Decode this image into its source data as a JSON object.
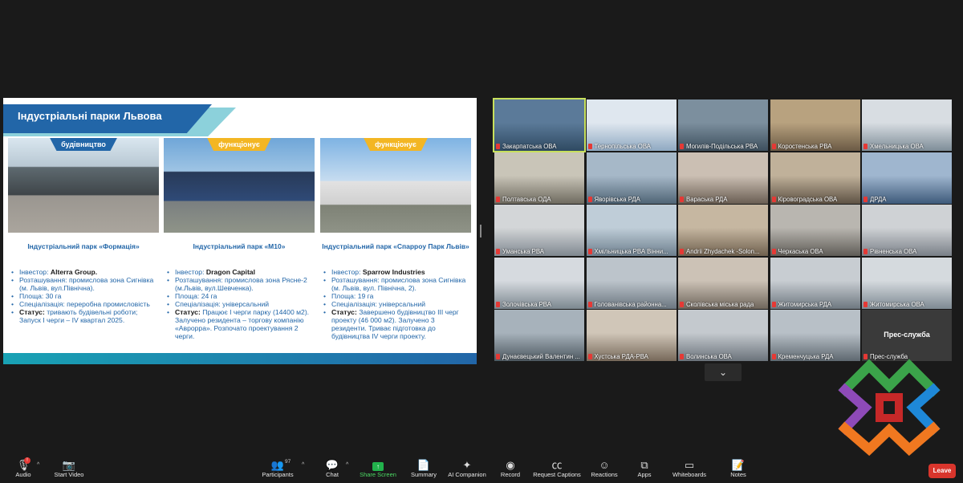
{
  "slide": {
    "title": "Індустріальні парки Львова",
    "parks": [
      {
        "badge": "будівництво",
        "name": "Індустріальний парк «Формація»",
        "details": [
          {
            "label": "Інвестор: ",
            "value": "Alterra Group."
          },
          {
            "label": "Розташування: промислова зона Сигнівка (м. Львів, вул.Північна).",
            "value": ""
          },
          {
            "label": "Площа: 30 га",
            "value": ""
          },
          {
            "label": "Спеціалізація: переробна промисловість",
            "value": ""
          },
          {
            "label": "",
            "value": "Статус:",
            "rest": " тривають будівельні роботи; Запуск I черги –  IV квартал 2025."
          }
        ]
      },
      {
        "badge": "функціонує",
        "name": "Індустріальний парк «М10»",
        "details": [
          {
            "label": "Інвестор: ",
            "value": "Dragon Capital"
          },
          {
            "label": "Розташування: промислова зона Рясне-2 (м.Львів, вул.Шевченка).",
            "value": ""
          },
          {
            "label": "Площа: 24 га",
            "value": ""
          },
          {
            "label": "Спеціалізація: універсальний",
            "value": ""
          },
          {
            "label": "",
            "value": "Статус:",
            "rest": " Працює I черги парку (14400 м2). Залучено резидента – торгову компанію «Аврорра». Розпочато проектування 2 черги."
          }
        ]
      },
      {
        "badge": "функціонує",
        "name": "Індустріальний парк «Спарроу Парк Львів»",
        "details": [
          {
            "label": "Інвестор: ",
            "value": "Sparrow Industries"
          },
          {
            "label": "Розташування: промислова зона Сигнівка (м. Львів, вул. Північна, 2).",
            "value": ""
          },
          {
            "label": "Площа: 19 га",
            "value": ""
          },
          {
            "label": "Спеціалізація: універсальний",
            "value": ""
          },
          {
            "label": "",
            "value": "Статус:",
            "rest": " Завершено будівництво III черг проекту (46 000 м2). Залучено 3 резиденти. Триває підготовка до будівництва IV черги проекту."
          }
        ]
      }
    ]
  },
  "tiles": [
    "Закарпатська ОВА",
    "Тернопільська ОВА",
    "Могилів-Подільська РВА",
    "Коростенська РВА",
    "Хмельницька ОВА",
    "Полтавська ОДА",
    "Яворівська РДА",
    "Вараська РДА",
    "Кіровоградська ОВА",
    "ДРДА",
    "Уманська РВА",
    "Хмільницька РВА Вінни...",
    "Andrii Zhydachek -Solon...",
    "Черкаська ОВА",
    "Рівненська ОВА",
    "Золочівська РВА",
    "Голованівська районна...",
    "Сколівська міська рада",
    "Житомирська РДА",
    "Житомирська ОВА",
    "Дунаєвецький Валентин ...",
    "Хустська РДА-РВА",
    "Волинська ОВА",
    "Кременчуцька РДА",
    "Прес-служба"
  ],
  "tile_center_name": "Прес-служба",
  "toolbar": {
    "audio": "Audio",
    "video": "Start Video",
    "participants": "Participants",
    "participants_count": "97",
    "chat": "Chat",
    "share": "Share Screen",
    "summary": "Summary",
    "ai": "AI Companion",
    "record": "Record",
    "captions": "Request Captions",
    "reactions": "Reactions",
    "apps": "Apps",
    "whiteboards": "Whiteboards",
    "notes": "Notes",
    "leave": "Leave",
    "audio_alert": "!"
  },
  "colors": {
    "accent_blue": "#2266a8",
    "badge_yellow": "#f3b623",
    "share_green": "#22b24c",
    "leave_red": "#d9352c"
  }
}
